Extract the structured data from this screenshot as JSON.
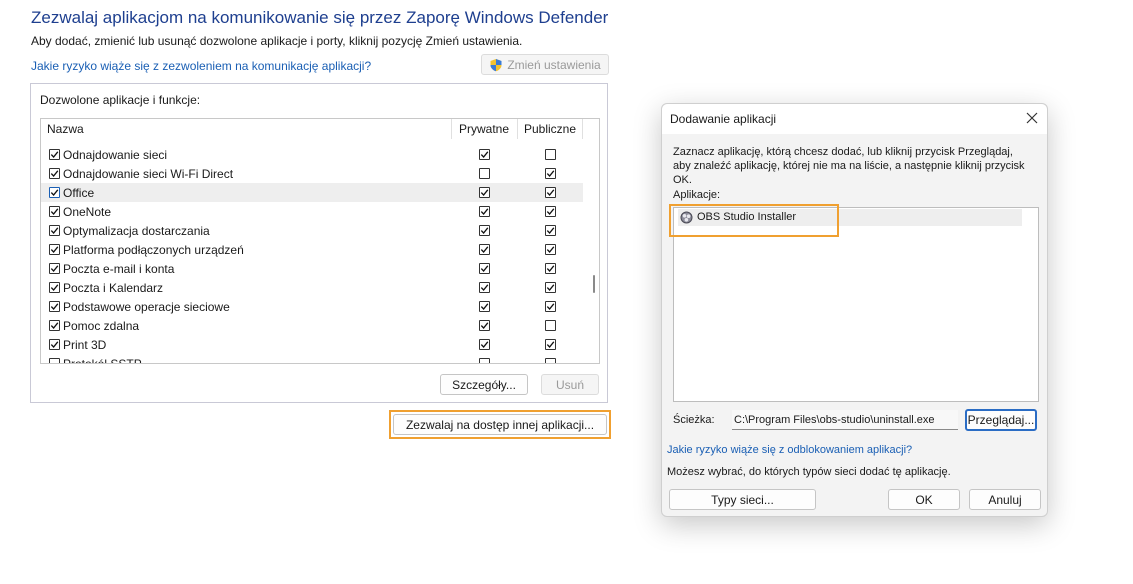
{
  "main": {
    "title": "Zezwalaj aplikacjom na komunikowanie się przez Zaporę Windows Defender",
    "subtitle": "Aby dodać, zmienić lub usunąć dozwolone aplikacje i porty, kliknij pozycję Zmień ustawienia.",
    "risk_link": "Jakie ryzyko wiąże się z zezwoleniem na komunikację aplikacji?",
    "change_settings_label": "Zmień ustawienia",
    "group_label": "Dozwolone aplikacje i funkcje:",
    "columns": [
      "Nazwa",
      "Prywatne",
      "Publiczne"
    ],
    "rows": [
      {
        "name": "Odnajdowanie sieci",
        "enabled": true,
        "private": true,
        "public": false
      },
      {
        "name": "Odnajdowanie sieci Wi-Fi Direct",
        "enabled": true,
        "private": false,
        "public": true
      },
      {
        "name": "Office",
        "enabled": true,
        "private": true,
        "public": true
      },
      {
        "name": "OneNote",
        "enabled": true,
        "private": true,
        "public": true
      },
      {
        "name": "Optymalizacja dostarczania",
        "enabled": true,
        "private": true,
        "public": true
      },
      {
        "name": "Platforma podłączonych urządzeń",
        "enabled": true,
        "private": true,
        "public": true
      },
      {
        "name": "Poczta e-mail i konta",
        "enabled": true,
        "private": true,
        "public": true
      },
      {
        "name": "Poczta i Kalendarz",
        "enabled": true,
        "private": true,
        "public": true
      },
      {
        "name": "Podstawowe operacje sieciowe",
        "enabled": true,
        "private": true,
        "public": true
      },
      {
        "name": "Pomoc zdalna",
        "enabled": true,
        "private": true,
        "public": false
      },
      {
        "name": "Print 3D",
        "enabled": true,
        "private": true,
        "public": true
      },
      {
        "name": "Protokół SSTP",
        "enabled": false,
        "private": false,
        "public": false
      }
    ],
    "details_label": "Szczegóły...",
    "remove_label": "Usuń",
    "allow_other_label": "Zezwalaj na dostęp innej aplikacji..."
  },
  "dialog": {
    "title": "Dodawanie aplikacji",
    "description": "Zaznacz aplikację, którą chcesz dodać, lub kliknij przycisk Przeglądaj, aby znaleźć aplikację, której nie ma na liście, a następnie kliknij przycisk OK.",
    "apps_label": "Aplikacje:",
    "apps": [
      "OBS Studio Installer"
    ],
    "path_label": "Ścieżka:",
    "path_value": "C:\\Program Files\\obs-studio\\uninstall.exe",
    "browse_label": "Przeglądaj...",
    "risk_link": "Jakie ryzyko wiąże się z odblokowaniem aplikacji?",
    "note": "Możesz wybrać, do których typów sieci dodać tę aplikację.",
    "network_types_label": "Typy sieci...",
    "ok_label": "OK",
    "cancel_label": "Anuluj"
  },
  "colors": {
    "title_blue": "#1e3f8f",
    "link_blue": "#1a5fb4",
    "highlight_orange": "#f0a030"
  }
}
